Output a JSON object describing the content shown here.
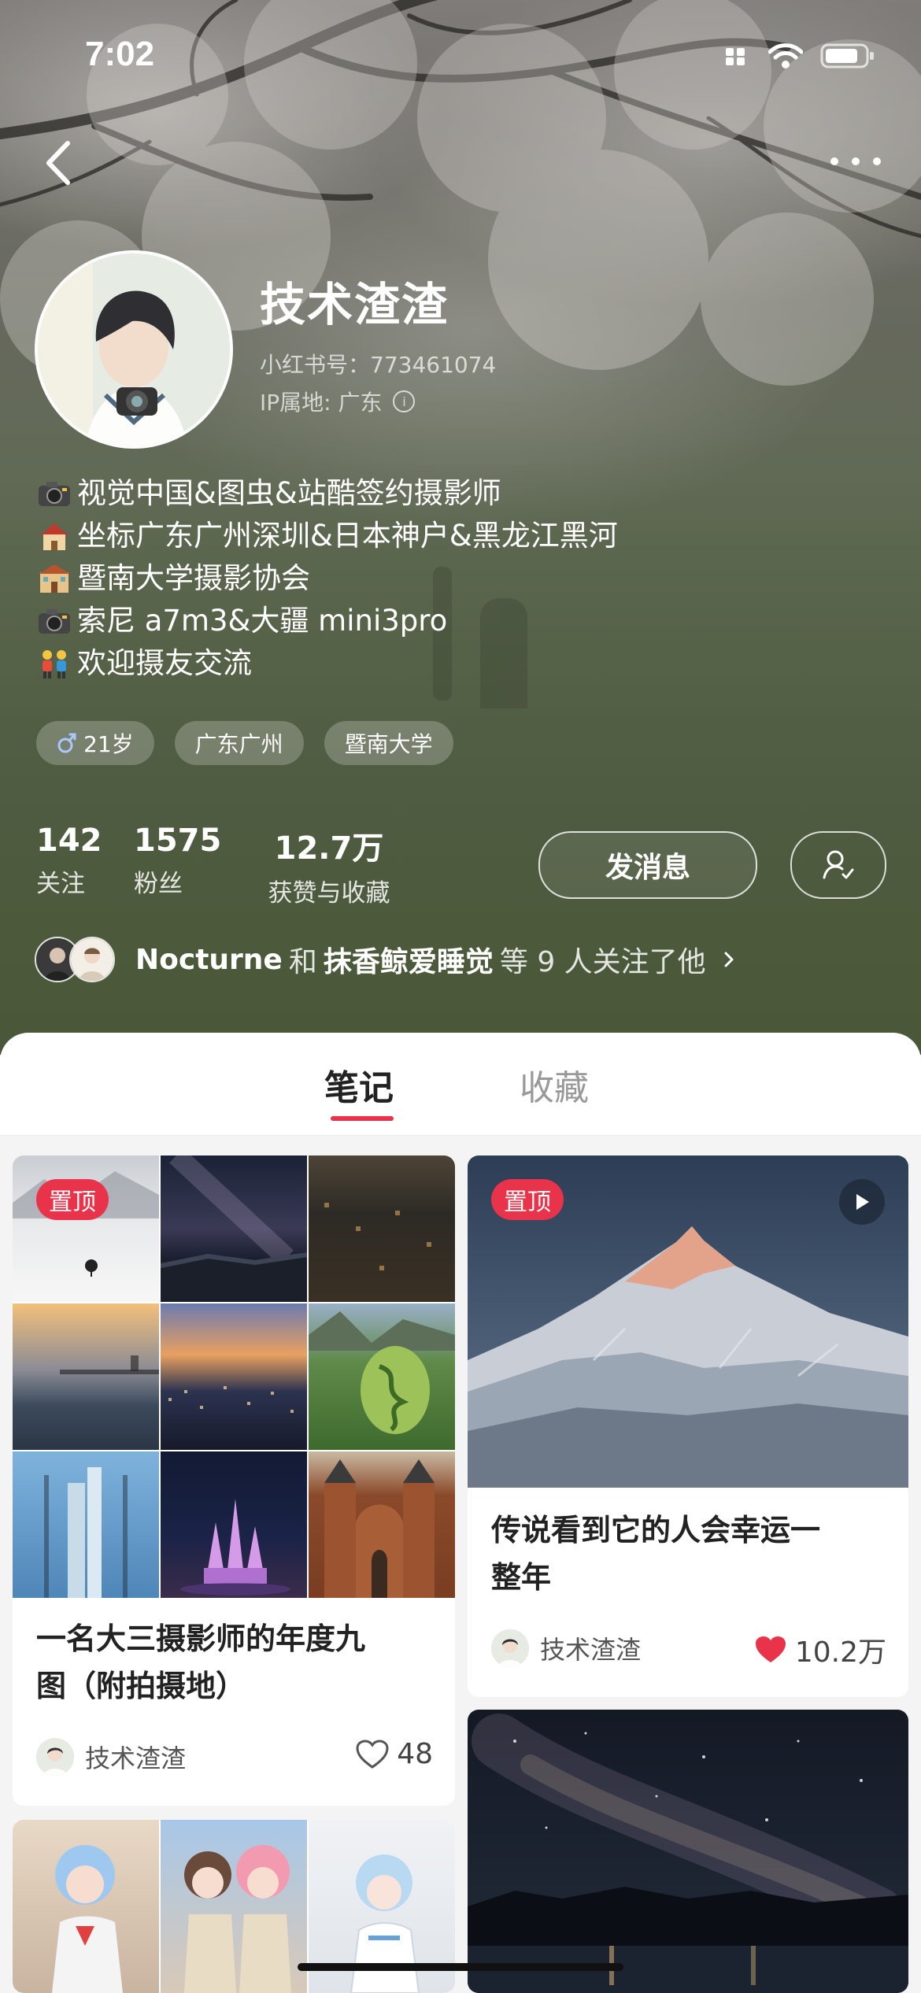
{
  "status": {
    "time": "7:02"
  },
  "profile": {
    "name": "技术渣渣",
    "red_id": "小红书号：773461074",
    "ip": "IP属地: 广东",
    "bio": [
      {
        "icon": "camera-emoji-icon",
        "text": "视觉中国&图虫&站酷签约摄影师"
      },
      {
        "icon": "house-emoji-icon",
        "text": "坐标广东广州深圳&日本神户&黑龙江黑河"
      },
      {
        "icon": "school-emoji-icon",
        "text": "暨南大学摄影协会"
      },
      {
        "icon": "camera-emoji-icon",
        "text": "索尼 a7m3&大疆 mini3pro"
      },
      {
        "icon": "two-people-emoji-icon",
        "text": "欢迎摄友交流"
      }
    ],
    "tags": [
      "21岁",
      "广东广州",
      "暨南大学"
    ],
    "stats": [
      {
        "num": "142",
        "label": "关注"
      },
      {
        "num": "1575",
        "label": "粉丝"
      },
      {
        "num": "12.7万",
        "label": "获赞与收藏"
      }
    ],
    "message_button": "发消息",
    "mutual": {
      "name1": "Nocturne",
      "and": "和",
      "name2": "抹香鲸爱睡觉",
      "suffix": "等 9 人关注了他"
    }
  },
  "tabs": {
    "notes": "笔记",
    "collect": "收藏"
  },
  "notes": [
    {
      "pinned": "置顶",
      "title_line1": "一名大三摄影师的年度九",
      "title_line2": "图（附拍摄地）",
      "author": "技术渣渣",
      "likes": "48",
      "liked": false
    },
    {
      "pinned": "置顶",
      "title_line1": "传说看到它的人会幸运一",
      "title_line2": "整年",
      "author": "技术渣渣",
      "likes": "10.2万",
      "liked": true,
      "video": true
    }
  ],
  "colors": {
    "accent": "#e8334a"
  }
}
